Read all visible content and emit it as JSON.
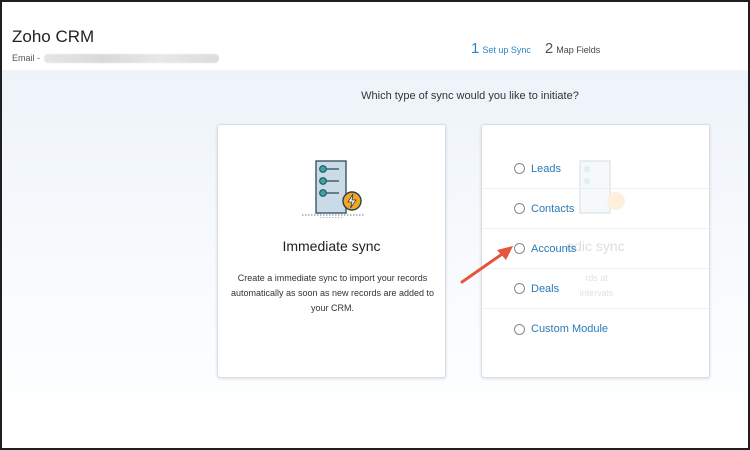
{
  "header": {
    "app_title": "Zoho CRM",
    "email_label": "Email -"
  },
  "steps": [
    {
      "number": "1",
      "label": "Set up Sync",
      "state": "active"
    },
    {
      "number": "2",
      "label": "Map Fields",
      "state": "inactive"
    }
  ],
  "question": "Which type of sync would you like to initiate?",
  "immediate_card": {
    "title": "Immediate sync",
    "description": "Create a immediate sync to import your records automatically as soon as new records are added to your CRM.",
    "icon": "immediate-sync-illustration"
  },
  "periodic_card": {
    "ghost_title": "odic sync",
    "ghost_desc": "rds at",
    "ghost_desc2": "intervals"
  },
  "module_options": [
    {
      "label": "Leads"
    },
    {
      "label": "Contacts"
    },
    {
      "label": "Accounts"
    },
    {
      "label": "Deals"
    },
    {
      "label": "Custom Module"
    }
  ],
  "colors": {
    "accent": "#2a85c7",
    "link": "#2a7ab8",
    "arrow": "#e5553b",
    "bolt": "#f5a623"
  }
}
